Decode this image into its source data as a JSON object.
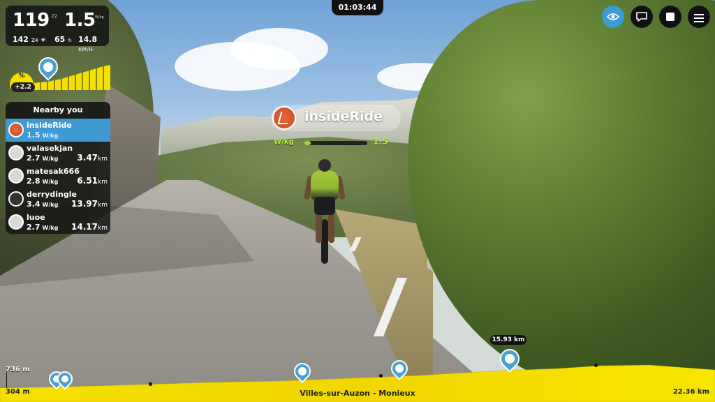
{
  "timer": "01:03:44",
  "stats": {
    "power": "119",
    "zone": "Z2",
    "wkg": "1.5",
    "wkg_unit": "W/kg",
    "heart_rate": "142",
    "hr_zone": "Z4",
    "cadence": "65",
    "speed": "14.8",
    "speed_unit": "KM/H"
  },
  "grade": {
    "label": "%",
    "value": "+2.2"
  },
  "nearby": {
    "title": "Nearby you",
    "riders": [
      {
        "name": "insideRide",
        "wkg": "1.5",
        "unit": "W/kg",
        "distance": "",
        "active": true
      },
      {
        "name": "valasekjan",
        "wkg": "2.7",
        "unit": "W/kg",
        "distance": "3.47",
        "dunit": "km"
      },
      {
        "name": "matesak666",
        "wkg": "2.8",
        "unit": "W/kg",
        "distance": "6.51",
        "dunit": "km"
      },
      {
        "name": "derrydingle",
        "wkg": "3.4",
        "unit": "W/kg",
        "distance": "13.97",
        "dunit": "km"
      },
      {
        "name": "luoe",
        "wkg": "2.7",
        "unit": "W/kg",
        "distance": "14.17",
        "dunit": "km"
      }
    ]
  },
  "rider_label": {
    "name": "insideRide",
    "wkg_label": "W/kg",
    "wkg_value": "1.5",
    "wkg_fill": 0.1
  },
  "profile": {
    "elev_max": "736 m",
    "elev_min": "304 m",
    "route": "Villes-sur-Auzon - Monieux",
    "distance": "22.36 km",
    "gap": "15.93 km"
  },
  "icons": [
    "eye-icon",
    "chat-icon",
    "stop-icon",
    "menu-icon",
    "rider-pin-icon"
  ],
  "colors": {
    "accent": "#3d9bd2",
    "profile": "#f4e100",
    "wkg": "#8fdc2a"
  }
}
